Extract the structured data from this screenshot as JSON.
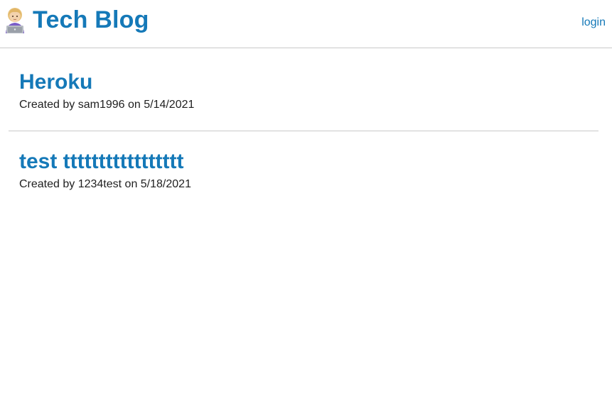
{
  "header": {
    "site_title": "Tech Blog",
    "brand_icon": "technologist-emoji-icon",
    "login_label": "login"
  },
  "posts": [
    {
      "title": "Heroku",
      "meta": "Created by sam1996 on 5/14/2021"
    },
    {
      "title": "test ttttttttttttttttt",
      "meta": "Created by 1234test on 5/18/2021"
    }
  ],
  "colors": {
    "accent": "#1579b8",
    "divider": "#c9c9c9",
    "text": "#1f1f1f",
    "background": "#ffffff"
  }
}
